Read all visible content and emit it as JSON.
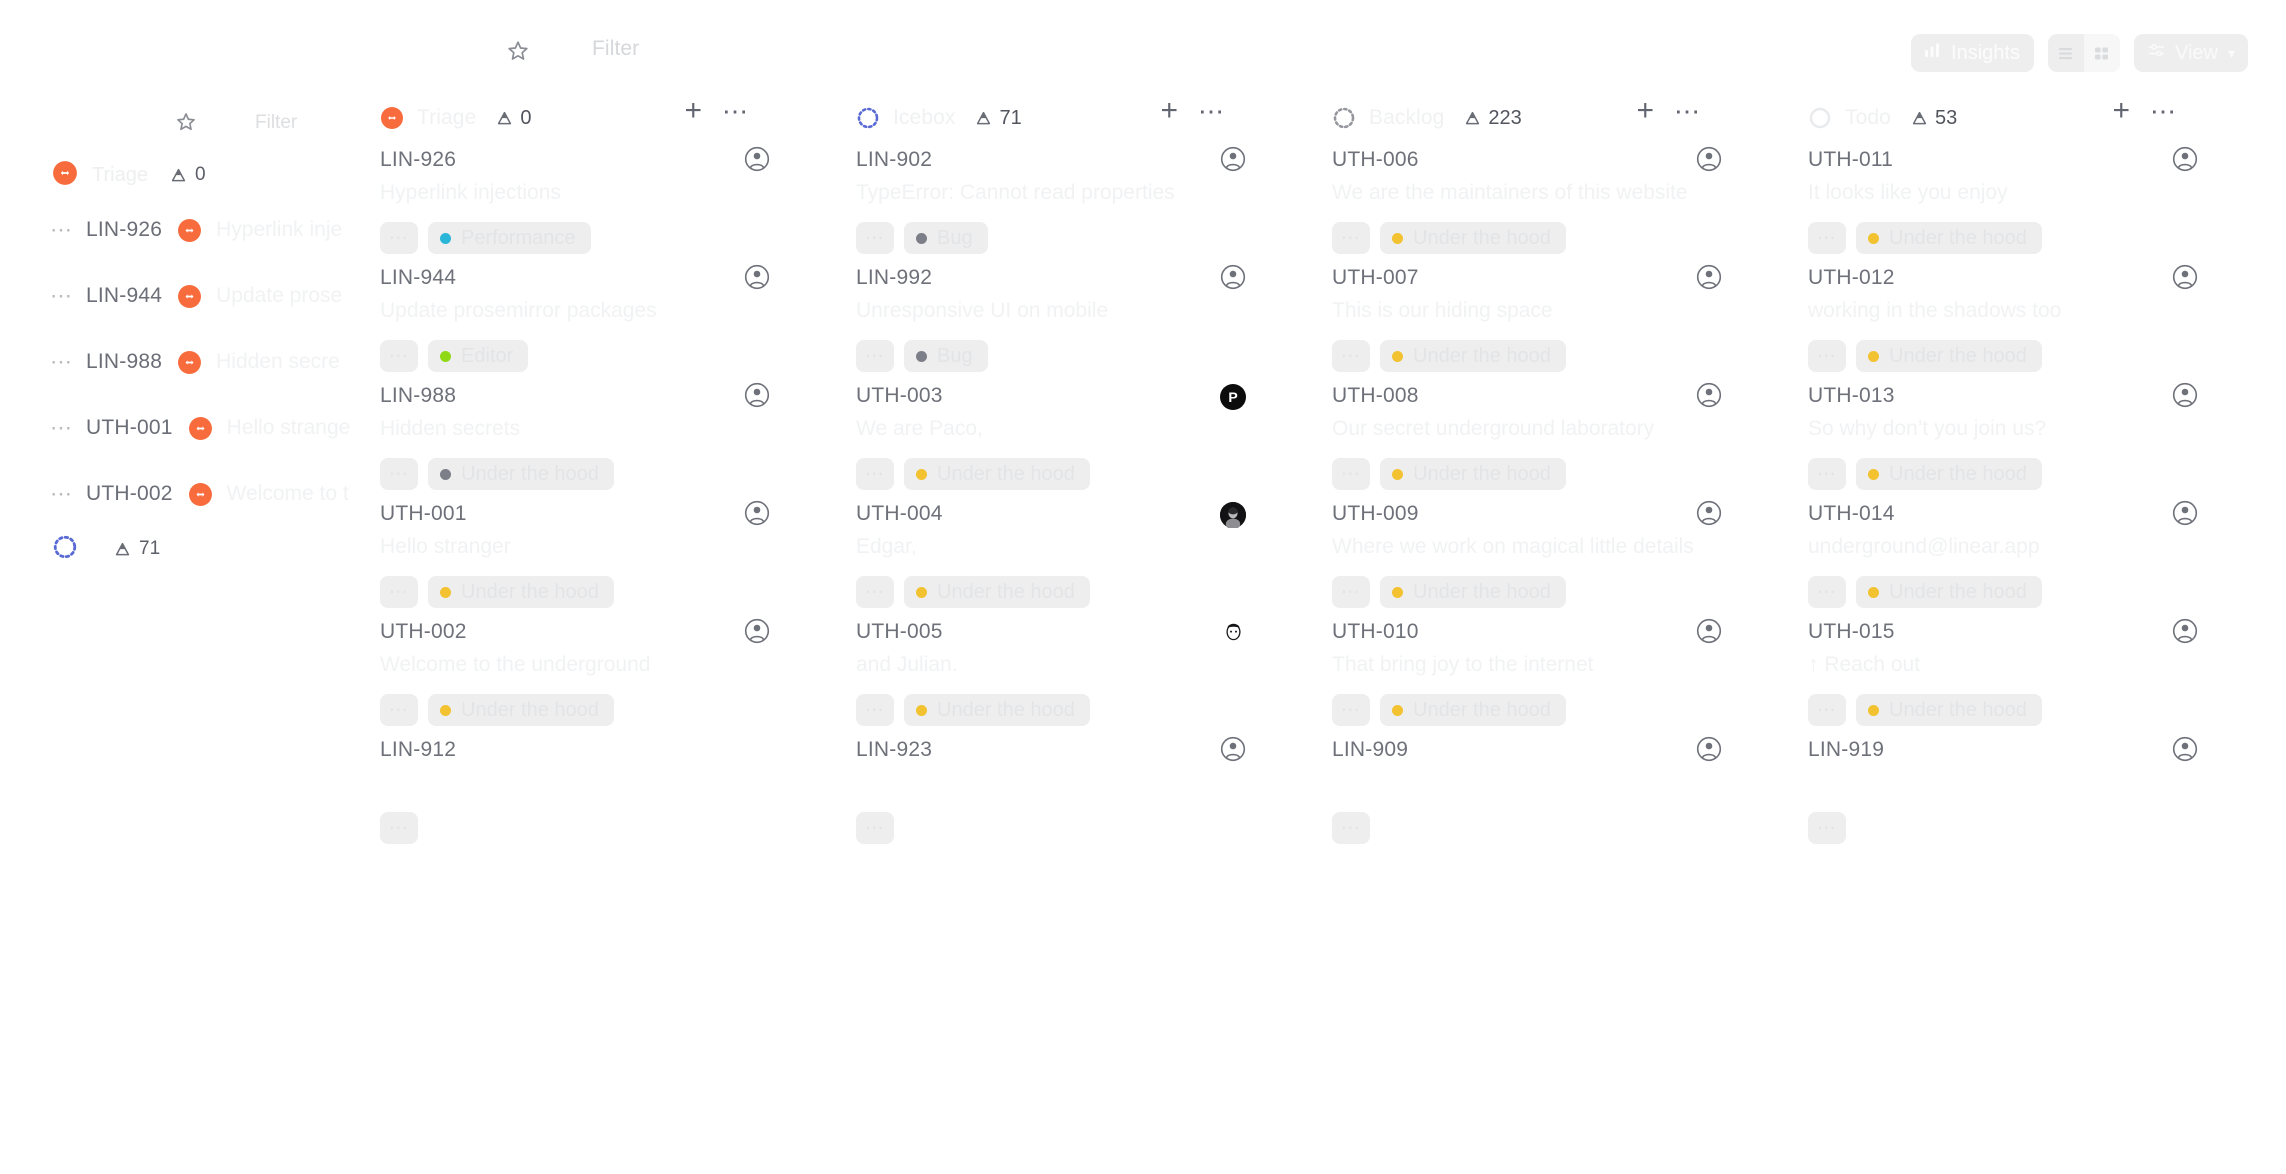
{
  "toolbar": {
    "star_icon": "star-icon",
    "filter_label": "Filter",
    "insights_label": "Insights",
    "insights_icon": "bar-chart-icon",
    "view_list_icon": "list-view-icon",
    "view_grid_icon": "grid-view-icon",
    "view_label": "View",
    "view_icon": "sliders-icon",
    "chevron": "⌄"
  },
  "list_layer": {
    "star_icon": "star-icon",
    "filter_label": "Filter",
    "groups": [
      {
        "status": "triage",
        "label": "Triage",
        "count": "0",
        "count_icon": "priority-icon",
        "rows": [
          {
            "dots": "⋯",
            "id": "LIN-926",
            "status": "triage",
            "title": "Hyperlink inje"
          },
          {
            "dots": "⋯",
            "id": "LIN-944",
            "status": "triage",
            "title": "Update prose"
          },
          {
            "dots": "⋯",
            "id": "LIN-988",
            "status": "triage",
            "title": "Hidden secre"
          },
          {
            "dots": "⋯",
            "id": "UTH-001",
            "status": "triage",
            "title": "Hello strange"
          },
          {
            "dots": "⋯",
            "id": "UTH-002",
            "status": "triage",
            "title": "Welcome to t"
          }
        ]
      },
      {
        "status": "icebox",
        "label": "",
        "count": "71",
        "count_icon": "priority-icon",
        "rows": []
      }
    ]
  },
  "board": {
    "add_icon": "plus-icon",
    "more_icon": "more-horizontal-icon",
    "priority_icon": "priority-icon",
    "avatar_icon": "user-avatar-icon",
    "columns": [
      {
        "name": "Triage",
        "status": "triage",
        "count": "0",
        "cards": [
          {
            "id": "LIN-926",
            "title": "Hyperlink injections",
            "avatar": "default",
            "label": "Performance",
            "label_color": "#2ab6d9",
            "dots": "⋯"
          },
          {
            "id": "LIN-944",
            "title": "Update prosemirror packages",
            "avatar": "default",
            "label": "Editor",
            "label_color": "#8fd916",
            "dots": "⋯"
          },
          {
            "id": "LIN-988",
            "title": "Hidden secrets",
            "avatar": "default",
            "label": "Under the hood",
            "label_color": "#7c7f88",
            "dots": "⋯"
          },
          {
            "id": "UTH-001",
            "title": "Hello stranger",
            "avatar": "default",
            "label": "Under the hood",
            "label_color": "#f2c230",
            "dots": "⋯"
          },
          {
            "id": "UTH-002",
            "title": "Welcome to the underground",
            "avatar": "default",
            "label": "Under the hood",
            "label_color": "#f2c230",
            "dots": "⋯"
          },
          {
            "id": "LIN-912",
            "title": "",
            "avatar": "none",
            "label": "",
            "label_color": "",
            "dots": "⋯"
          }
        ]
      },
      {
        "name": "Icebox",
        "status": "icebox",
        "count": "71",
        "cards": [
          {
            "id": "LIN-902",
            "title": "TypeError: Cannot read properties",
            "avatar": "default",
            "label": "Bug",
            "label_color": "#7c7f88",
            "dots": "⋯"
          },
          {
            "id": "LIN-992",
            "title": "Unresponsive UI on mobile",
            "avatar": "default",
            "label": "Bug",
            "label_color": "#7c7f88",
            "dots": "⋯"
          },
          {
            "id": "UTH-003",
            "title": "We are Paco,",
            "avatar": "letter-P",
            "label": "Under the hood",
            "label_color": "#f2c230",
            "dots": "⋯"
          },
          {
            "id": "UTH-004",
            "title": "Edgar,",
            "avatar": "photo",
            "label": "Under the hood",
            "label_color": "#f2c230",
            "dots": "⋯"
          },
          {
            "id": "UTH-005",
            "title": "and Julian.",
            "avatar": "illustration",
            "label": "Under the hood",
            "label_color": "#f2c230",
            "dots": "⋯"
          },
          {
            "id": "LIN-923",
            "title": "",
            "avatar": "default",
            "label": "",
            "label_color": "",
            "dots": "⋯"
          }
        ]
      },
      {
        "name": "Backlog",
        "status": "backlog",
        "count": "223",
        "cards": [
          {
            "id": "UTH-006",
            "title": "We are the maintainers of this website",
            "avatar": "default",
            "label": "Under the hood",
            "label_color": "#f2c230",
            "dots": "⋯"
          },
          {
            "id": "UTH-007",
            "title": "This is our hiding space",
            "avatar": "default",
            "label": "Under the hood",
            "label_color": "#f2c230",
            "dots": "⋯"
          },
          {
            "id": "UTH-008",
            "title": "Our secret underground laboratory",
            "avatar": "default",
            "label": "Under the hood",
            "label_color": "#f2c230",
            "dots": "⋯"
          },
          {
            "id": "UTH-009",
            "title": "Where we work on magical little details",
            "avatar": "default",
            "label": "Under the hood",
            "label_color": "#f2c230",
            "dots": "⋯"
          },
          {
            "id": "UTH-010",
            "title": "That bring joy to the internet",
            "avatar": "default",
            "label": "Under the hood",
            "label_color": "#f2c230",
            "dots": "⋯"
          },
          {
            "id": "LIN-909",
            "title": "",
            "avatar": "default",
            "label": "",
            "label_color": "",
            "dots": "⋯"
          }
        ]
      },
      {
        "name": "Todo",
        "status": "todo",
        "count": "53",
        "cards": [
          {
            "id": "UTH-011",
            "title": "It looks like you enjoy",
            "avatar": "default",
            "label": "Under the hood",
            "label_color": "#f2c230",
            "dots": "⋯"
          },
          {
            "id": "UTH-012",
            "title": "working in the shadows too",
            "avatar": "default",
            "label": "Under the hood",
            "label_color": "#f2c230",
            "dots": "⋯"
          },
          {
            "id": "UTH-013",
            "title": "So why don’t you join us?",
            "avatar": "default",
            "label": "Under the hood",
            "label_color": "#f2c230",
            "dots": "⋯"
          },
          {
            "id": "UTH-014",
            "title": "underground@linear.app",
            "avatar": "default",
            "label": "Under the hood",
            "label_color": "#f2c230",
            "dots": "⋯"
          },
          {
            "id": "UTH-015",
            "title": "↑ Reach out",
            "avatar": "default",
            "label": "Under the hood",
            "label_color": "#f2c230",
            "dots": "⋯"
          },
          {
            "id": "LIN-919",
            "title": "",
            "avatar": "default",
            "label": "",
            "label_color": "",
            "dots": "⋯"
          }
        ]
      }
    ]
  },
  "colors": {
    "triage_orange": "#f76b3c",
    "icebox_blue": "#5a6ad4",
    "backlog_gray": "#95979d",
    "todo_gray": "#e9eaec",
    "label_yellow": "#f2c230",
    "label_green": "#8fd916",
    "label_cyan": "#2ab6d9",
    "label_gray": "#7c7f88"
  }
}
